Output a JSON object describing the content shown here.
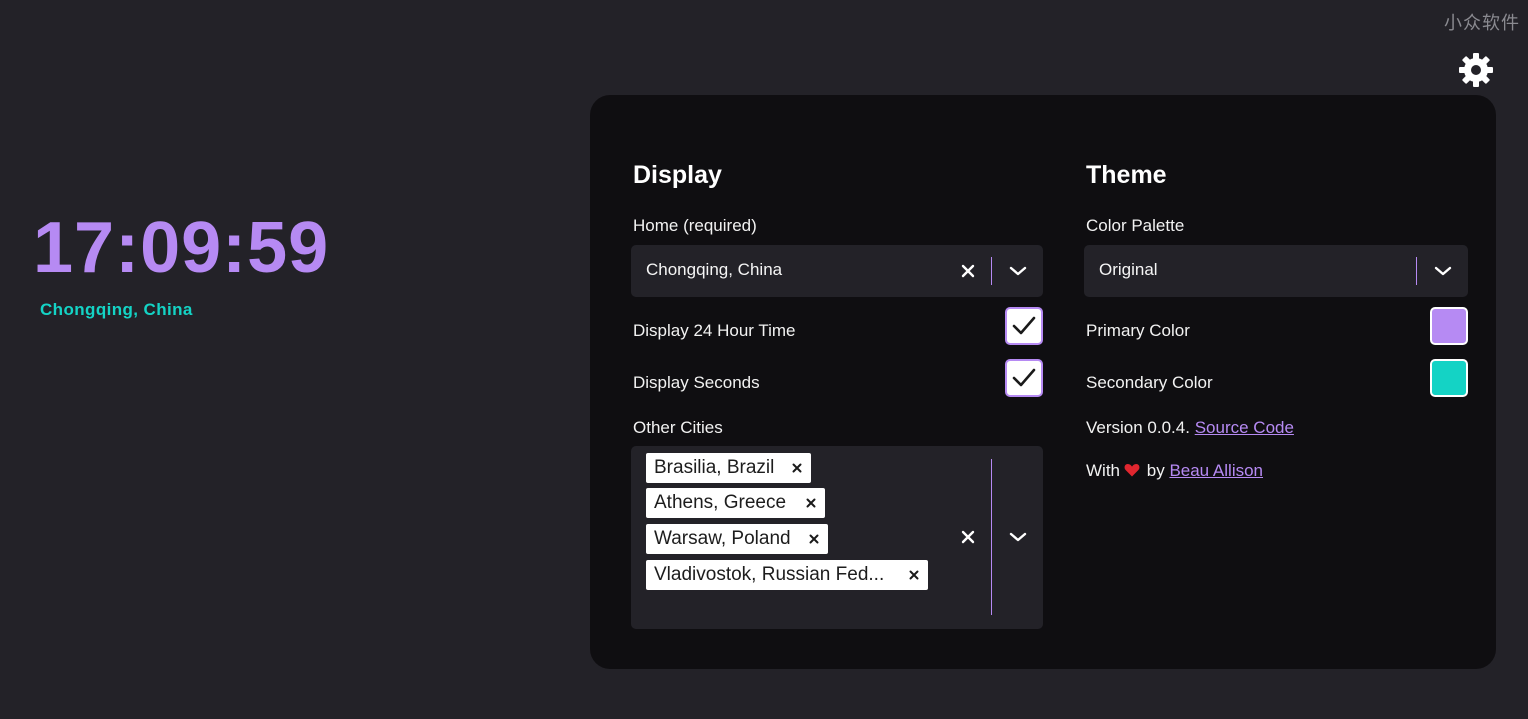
{
  "watermark": "小众软件",
  "clock": {
    "time": "17:09:59",
    "city": "Chongqing, China"
  },
  "colors": {
    "primary": "#b68af3",
    "secondary": "#14d3c5",
    "panel_bg": "#0f0e11",
    "page_bg": "#232228"
  },
  "icons": {
    "settings": "gear-icon",
    "clear": "close-icon",
    "dropdown": "chevron-down-icon",
    "check": "check-icon",
    "heart": "heart-icon"
  },
  "display": {
    "title": "Display",
    "home_label": "Home (required)",
    "home_value": "Chongqing, China",
    "display_24h_label": "Display 24 Hour Time",
    "display_24h_checked": true,
    "display_seconds_label": "Display Seconds",
    "display_seconds_checked": true,
    "other_cities_label": "Other Cities",
    "other_cities": [
      "Brasilia, Brazil",
      "Athens, Greece",
      "Warsaw, Poland",
      "Vladivostok, Russian Fed..."
    ]
  },
  "theme": {
    "title": "Theme",
    "palette_label": "Color Palette",
    "palette_value": "Original",
    "primary_label": "Primary Color",
    "secondary_label": "Secondary Color",
    "version_text": "Version 0.0.4.",
    "source_link": "Source Code",
    "with_text": "With",
    "by_text": "by",
    "author_link": "Beau Allison"
  }
}
